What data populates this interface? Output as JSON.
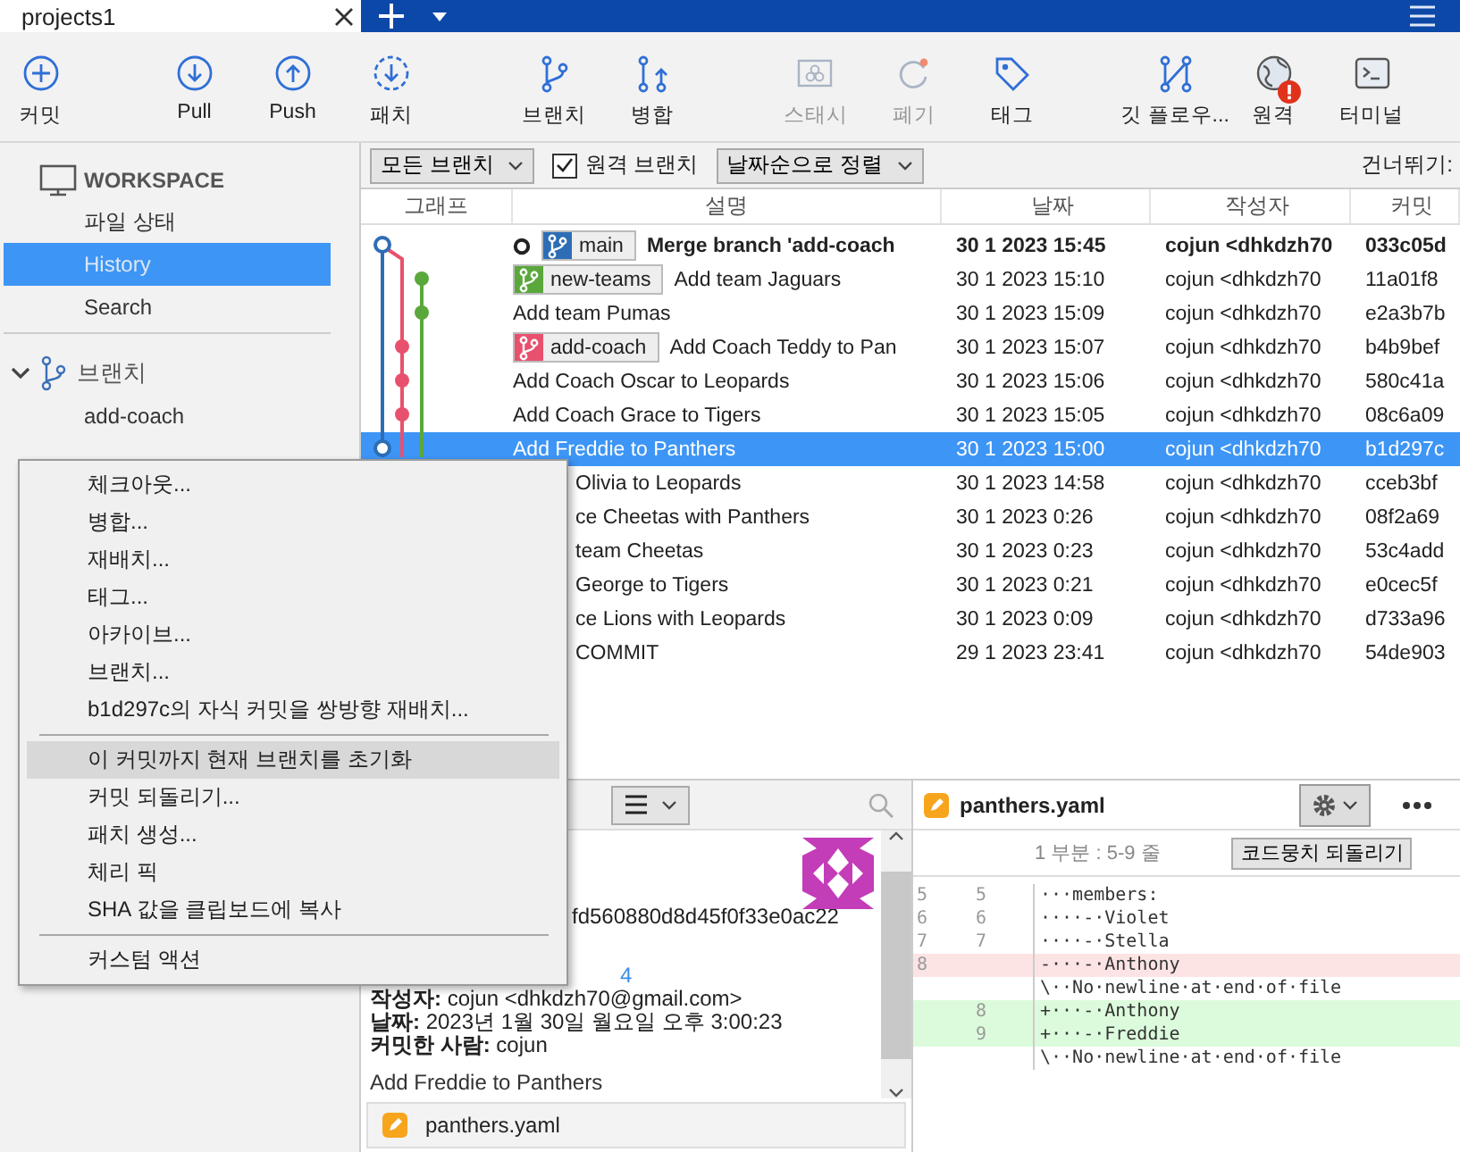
{
  "window": {
    "tab_title": "projects1"
  },
  "toolbar": {
    "groups": [
      [
        {
          "label": "커밋",
          "kind": "commit",
          "disabled": false,
          "alert": false
        }
      ],
      [
        {
          "label": "Pull",
          "kind": "pull",
          "disabled": false,
          "alert": false
        },
        {
          "label": "Push",
          "kind": "push",
          "disabled": false,
          "alert": false
        },
        {
          "label": "패치",
          "kind": "patch",
          "disabled": false,
          "alert": false
        }
      ],
      [
        {
          "label": "브랜치",
          "kind": "branch",
          "disabled": false,
          "alert": false
        },
        {
          "label": "병합",
          "kind": "merge",
          "disabled": false,
          "alert": false
        }
      ],
      [
        {
          "label": "스태시",
          "kind": "stash",
          "disabled": true,
          "alert": false
        },
        {
          "label": "폐기",
          "kind": "discard",
          "disabled": true,
          "alert": false
        },
        {
          "label": "태그",
          "kind": "tag",
          "disabled": false,
          "alert": false
        }
      ],
      [
        {
          "label": "깃 플로우...",
          "kind": "flow",
          "disabled": false,
          "alert": false
        },
        {
          "label": "원격",
          "kind": "remote",
          "disabled": false,
          "alert": true
        },
        {
          "label": "터미널",
          "kind": "terminal",
          "disabled": false,
          "alert": false
        }
      ]
    ]
  },
  "sidebar": {
    "workspace": {
      "title": "WORKSPACE",
      "items": [
        {
          "label": "파일 상태",
          "selected": false
        },
        {
          "label": "History",
          "selected": true
        },
        {
          "label": "Search",
          "selected": false
        }
      ]
    },
    "branches": {
      "title": "브랜치",
      "expanded": true,
      "items": [
        {
          "label": "add-coach"
        }
      ]
    }
  },
  "filter_bar": {
    "branch_filter": "모든 브랜치",
    "remote_branches": {
      "label": "원격 브랜치",
      "checked": true
    },
    "sort": "날짜순으로 정렬",
    "jump_label": "건너뛰기:"
  },
  "table": {
    "columns": [
      "그래프",
      "설명",
      "날짜",
      "작성자",
      "커밋"
    ],
    "rows": [
      {
        "message": "Merge branch 'add-coach",
        "date": "30 1 2023 15:45",
        "author": "cojun <dhkdzh70",
        "hash": "033c05d",
        "current": true,
        "selected": false,
        "branches": [
          {
            "name": "main",
            "color": "#2d6db5"
          }
        ]
      },
      {
        "message": "Add team Jaguars",
        "date": "30 1 2023 15:10",
        "author": "cojun <dhkdzh70",
        "hash": "11a01f8",
        "current": false,
        "selected": false,
        "branches": [
          {
            "name": "new-teams",
            "color": "#5aa83c"
          }
        ]
      },
      {
        "message": "Add team Pumas",
        "date": "30 1 2023 15:09",
        "author": "cojun <dhkdzh70",
        "hash": "e2a3b7b",
        "current": false,
        "selected": false,
        "branches": []
      },
      {
        "message": "Add Coach Teddy to Pan",
        "date": "30 1 2023 15:07",
        "author": "cojun <dhkdzh70",
        "hash": "b4b9bef",
        "current": false,
        "selected": false,
        "branches": [
          {
            "name": "add-coach",
            "color": "#e8516d"
          }
        ]
      },
      {
        "message": "Add Coach Oscar to Leopards",
        "date": "30 1 2023 15:06",
        "author": "cojun <dhkdzh70",
        "hash": "580c41a",
        "current": false,
        "selected": false,
        "branches": []
      },
      {
        "message": "Add Coach Grace to Tigers",
        "date": "30 1 2023 15:05",
        "author": "cojun <dhkdzh70",
        "hash": "08c6a09",
        "current": false,
        "selected": false,
        "branches": []
      },
      {
        "message": "Add Freddie to Panthers",
        "date": "30 1 2023 15:00",
        "author": "cojun <dhkdzh70",
        "hash": "b1d297c",
        "current": false,
        "selected": true,
        "branches": []
      },
      {
        "message": "Olivia to Leopards",
        "date": "30 1 2023 14:58",
        "author": "cojun <dhkdzh70",
        "hash": "cceb3bf",
        "current": false,
        "selected": false,
        "branches": []
      },
      {
        "message": "ce Cheetas with Panthers",
        "date": "30 1 2023 0:26",
        "author": "cojun <dhkdzh70",
        "hash": "08f2a69",
        "current": false,
        "selected": false,
        "branches": []
      },
      {
        "message": "team Cheetas",
        "date": "30 1 2023 0:23",
        "author": "cojun <dhkdzh70",
        "hash": "53c4add",
        "current": false,
        "selected": false,
        "branches": []
      },
      {
        "message": "George to Tigers",
        "date": "30 1 2023 0:21",
        "author": "cojun <dhkdzh70",
        "hash": "e0cec5f",
        "current": false,
        "selected": false,
        "branches": []
      },
      {
        "message": "ce Lions with Leopards",
        "date": "30 1 2023 0:09",
        "author": "cojun <dhkdzh70",
        "hash": "d733a96",
        "current": false,
        "selected": false,
        "branches": []
      },
      {
        "message": "COMMIT",
        "date": "29 1 2023 23:41",
        "author": "cojun <dhkdzh70",
        "hash": "54de903",
        "current": false,
        "selected": false,
        "branches": []
      }
    ]
  },
  "context_menu": {
    "groups": [
      [
        {
          "label": "체크아웃...",
          "selected": false
        },
        {
          "label": "병합...",
          "selected": false
        },
        {
          "label": "재배치...",
          "selected": false
        },
        {
          "label": "태그...",
          "selected": false
        },
        {
          "label": "아카이브...",
          "selected": false
        },
        {
          "label": "브랜치...",
          "selected": false
        },
        {
          "label": "b1d297c의 자식 커밋을 쌍방향 재배치...",
          "selected": false
        }
      ],
      [
        {
          "label": "이 커밋까지 현재 브랜치를 초기화",
          "selected": true
        },
        {
          "label": "커밋 되돌리기...",
          "selected": false
        },
        {
          "label": "패치 생성...",
          "selected": false
        },
        {
          "label": "체리 픽",
          "selected": false
        },
        {
          "label": "SHA 값을 클립보드에 복사",
          "selected": false
        }
      ],
      [
        {
          "label": "커스텀 액션",
          "selected": false
        }
      ]
    ]
  },
  "details": {
    "hash_fragment": "fd560880d8d45f0f33e0ac22",
    "parent_fragment": "4",
    "lines": [
      "**작성자:** cojun <dhkdzh70@gmail.com>",
      "**날짜:** 2023년 1월 30일 월요일 오후 3:00:23",
      "**커밋한 사람:** cojun"
    ],
    "message": "Add Freddie to Panthers",
    "files": [
      {
        "name": "panthers.yaml"
      }
    ]
  },
  "diff": {
    "file": "panthers.yaml",
    "hunk_title": "1 부분 : 5-9 줄",
    "hunk_button": "코드뭉치 되돌리기",
    "lines": [
      {
        "kind": "context",
        "old": "5",
        "new": "5",
        "text": "···members:"
      },
      {
        "kind": "context",
        "old": "6",
        "new": "6",
        "text": "····-·Violet"
      },
      {
        "kind": "context",
        "old": "7",
        "new": "7",
        "text": "····-·Stella"
      },
      {
        "kind": "removed",
        "old": "8",
        "text": "-···-·Anthony"
      },
      {
        "kind": "context",
        "text": "\\··No·newline·at·end·of·file"
      },
      {
        "kind": "added",
        "new": "8",
        "text": "+···-·Anthony"
      },
      {
        "kind": "added",
        "new": "9",
        "text": "+···-·Freddie"
      },
      {
        "kind": "context",
        "text": "\\··No·newline·at·end·of·file"
      }
    ]
  }
}
